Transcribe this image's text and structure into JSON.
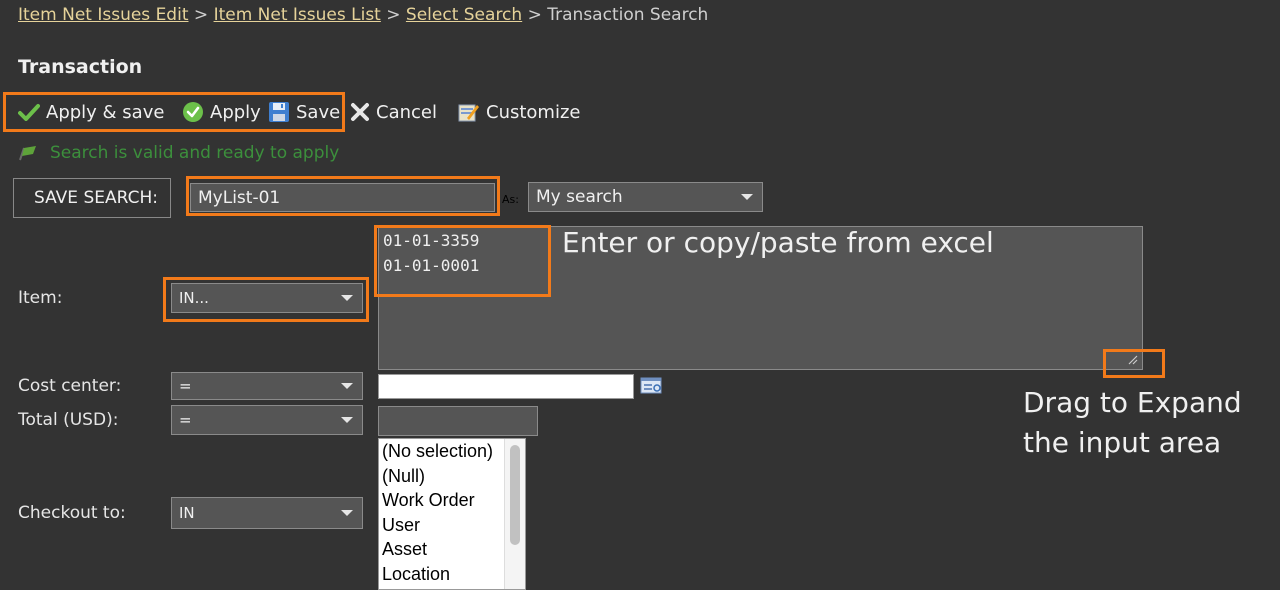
{
  "breadcrumb": {
    "items": [
      {
        "label": "Item Net Issues Edit",
        "link": true
      },
      {
        "label": "Item Net Issues List",
        "link": true
      },
      {
        "label": "Select Search",
        "link": true
      },
      {
        "label": "Transaction Search",
        "link": false
      }
    ],
    "separator": ">"
  },
  "page_title": "Transaction",
  "toolbar": {
    "apply_save_label": "Apply & save",
    "apply_label": "Apply",
    "save_label": "Save",
    "cancel_label": "Cancel",
    "customize_label": "Customize"
  },
  "status_message": "Search is valid and ready to apply",
  "save_search": {
    "label": "SAVE SEARCH:",
    "value": "MyList-01",
    "as_label": "As:",
    "as_value": "My search"
  },
  "filters": {
    "item": {
      "label": "Item:",
      "operator": "IN...",
      "values": [
        "01-01-3359",
        "01-01-0001"
      ]
    },
    "cost_center": {
      "label": "Cost center:",
      "operator": "="
    },
    "total": {
      "label": "Total (USD):",
      "operator": "="
    },
    "checkout_to": {
      "label": "Checkout to:",
      "operator": "IN",
      "options": [
        "(No selection)",
        "(Null)",
        "Work Order",
        "User",
        "Asset",
        "Location"
      ]
    }
  },
  "annotations": {
    "paste_hint": "Enter or copy/paste from excel",
    "drag_hint_line1": "Drag to Expand",
    "drag_hint_line2": "the input area"
  },
  "colors": {
    "background": "#333333",
    "highlight": "#f27a1a",
    "status_green": "#3c8f3c",
    "link": "#e6d39a"
  }
}
